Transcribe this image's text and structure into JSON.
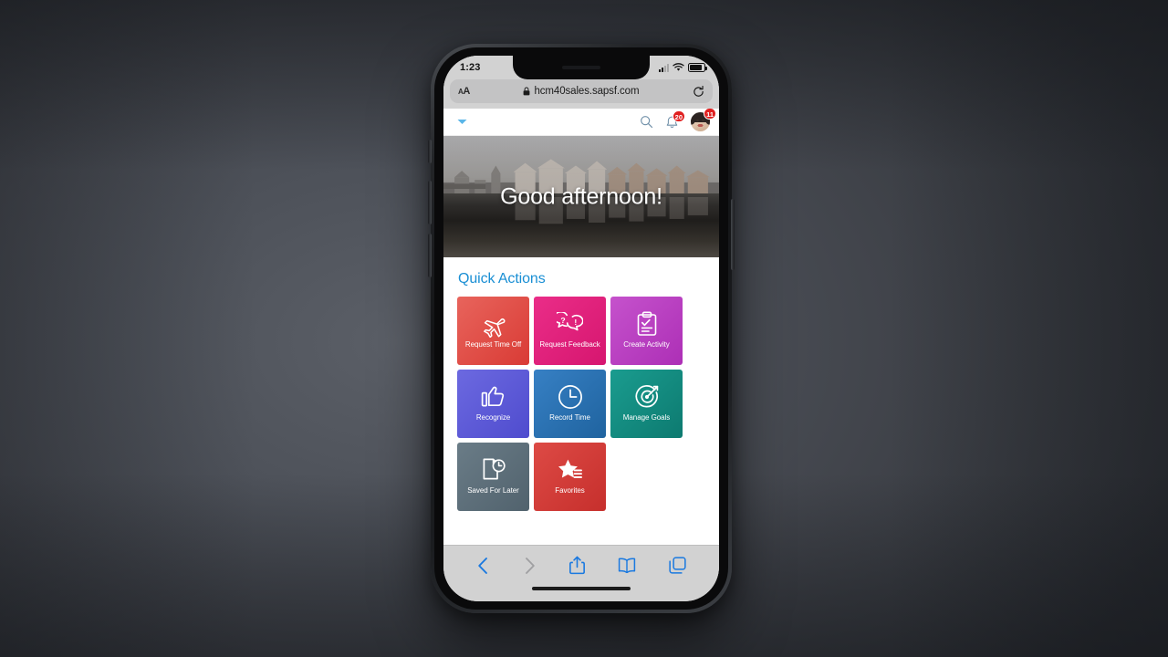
{
  "background": {
    "color": "#4d5159"
  },
  "device": {
    "name": "iphone-x",
    "frame_color": "#131416"
  },
  "status_bar": {
    "time": "1:23",
    "signal_icon": "cellular-signal-icon",
    "wifi_icon": "wifi-icon",
    "battery_icon": "battery-icon"
  },
  "browser": {
    "name": "safari",
    "text_size_label": "AA",
    "lock_icon": "lock-icon",
    "url": "hcm40sales.sapsf.com",
    "reload_icon": "reload-icon",
    "toolbar": [
      {
        "name": "back-button",
        "icon": "chevron-left-icon",
        "enabled": true
      },
      {
        "name": "forward-button",
        "icon": "chevron-right-icon",
        "enabled": false
      },
      {
        "name": "share-button",
        "icon": "share-icon",
        "enabled": true
      },
      {
        "name": "bookmarks-button",
        "icon": "book-icon",
        "enabled": true
      },
      {
        "name": "tabs-button",
        "icon": "tabs-icon",
        "enabled": true
      }
    ]
  },
  "app_header": {
    "menu_icon": "chevron-down-icon",
    "search_icon": "search-icon",
    "notifications": {
      "icon": "bell-icon",
      "badge": "20"
    },
    "profile": {
      "icon": "avatar",
      "badge": "11"
    }
  },
  "hero": {
    "greeting": "Good afternoon!",
    "image_description": "canal-cityscape-photo"
  },
  "quick_actions": {
    "title": "Quick Actions",
    "title_color": "#1a8fd4",
    "tiles": [
      {
        "label": "Request Time Off",
        "icon": "airplane-icon",
        "color": "#e04a44"
      },
      {
        "label": "Request Feedback",
        "icon": "speech-bubbles-icon",
        "color": "#e01f7a"
      },
      {
        "label": "Create Activity",
        "icon": "clipboard-check-icon",
        "color": "#bb3ec0"
      },
      {
        "label": "Recognize",
        "icon": "thumbs-up-icon",
        "color": "#5b58d8"
      },
      {
        "label": "Record Time",
        "icon": "clock-icon",
        "color": "#2a6db0"
      },
      {
        "label": "Manage Goals",
        "icon": "target-icon",
        "color": "#12897e"
      },
      {
        "label": "Saved For Later",
        "icon": "document-clock-icon",
        "color": "#5d6f7a"
      },
      {
        "label": "Favorites",
        "icon": "star-list-icon",
        "color": "#d13b3b"
      }
    ]
  }
}
